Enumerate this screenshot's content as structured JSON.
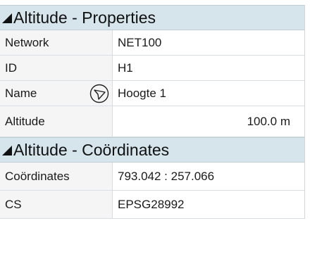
{
  "sections": [
    {
      "title": "Altitude - Properties",
      "rows": [
        {
          "label": "Network",
          "value": "NET100"
        },
        {
          "label": "ID",
          "value": "H1"
        },
        {
          "label": "Name",
          "value": "Hoogte 1"
        },
        {
          "label": "Altitude",
          "value": "100.0 m"
        }
      ]
    },
    {
      "title": "Altitude - Coördinates",
      "rows": [
        {
          "label": "Coördinates",
          "value": "793.042 : 257.066"
        },
        {
          "label": "CS",
          "value": "EPSG28992"
        }
      ]
    }
  ],
  "icons": {
    "name_icon": "navigation-arrow-icon",
    "collapse_icon": "collapse-triangle-icon"
  }
}
